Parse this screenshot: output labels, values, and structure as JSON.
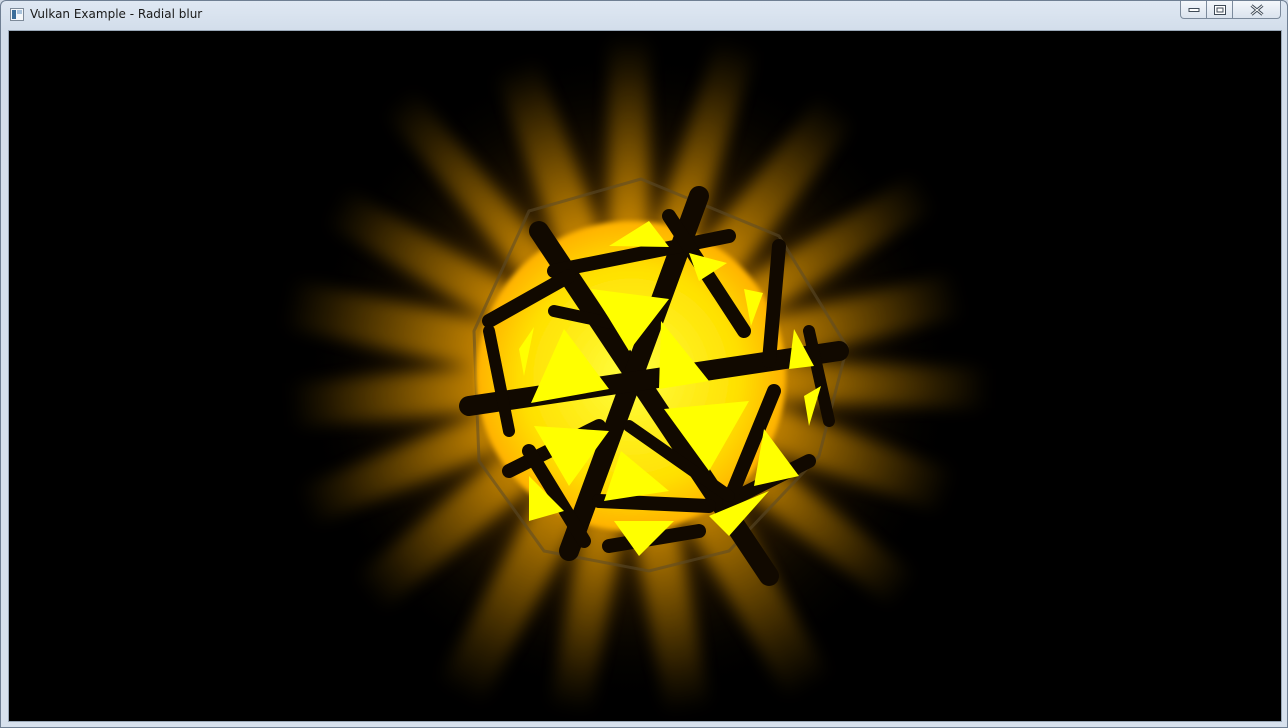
{
  "window": {
    "title": "Vulkan Example - Radial blur",
    "icon": "app-window-icon"
  },
  "controls": {
    "minimize_icon": "minimize-icon",
    "maximize_icon": "maximize-icon",
    "close_icon": "close-icon"
  },
  "scene": {
    "description_icon": "glowing-icosphere-render",
    "colors": {
      "background": "#000000",
      "core": "#ffff00",
      "glow": "#ffb300",
      "ray": "#d98a00"
    }
  }
}
